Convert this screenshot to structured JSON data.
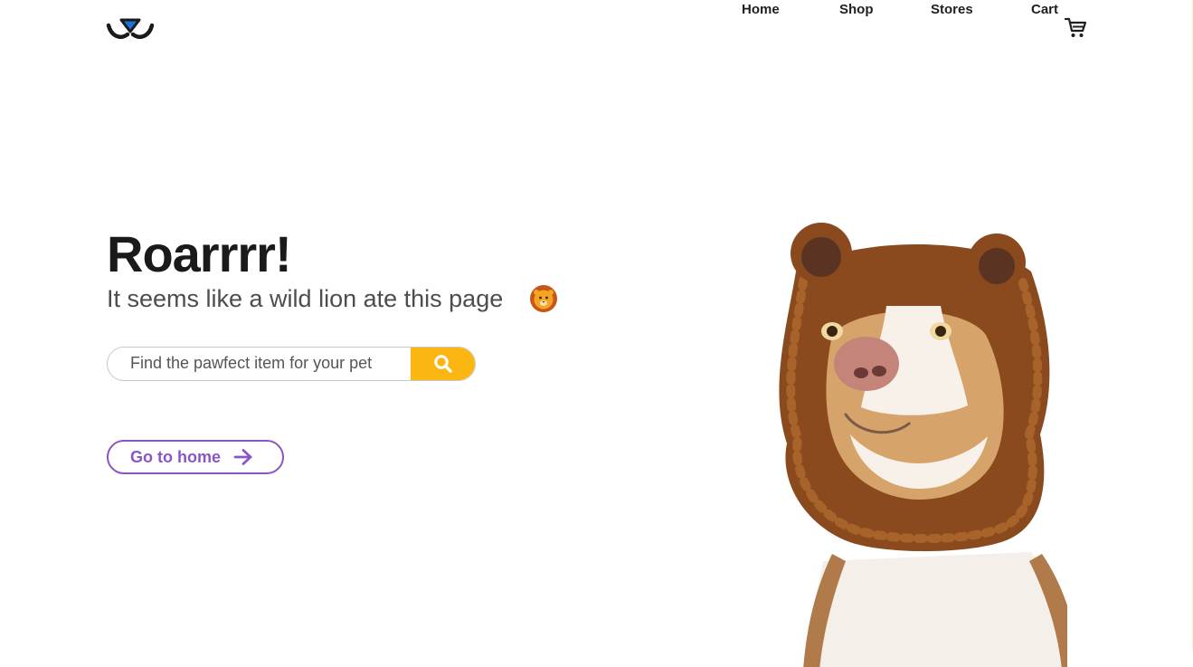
{
  "header": {
    "logo_icon": "paw-smile-logo-icon",
    "nav": {
      "home": "Home",
      "shop": "Shop",
      "stores": "Stores",
      "cart": "Cart"
    },
    "cart_icon": "shopping-cart-icon"
  },
  "hero": {
    "headline": "Roarrrr!",
    "subline": "It seems like a wild lion ate this page",
    "emoji_icon": "lion-face-emoji-icon"
  },
  "search": {
    "placeholder": "Find the pawfect item for your pet",
    "button_icon": "search-icon"
  },
  "home_button": {
    "label": "Go to home",
    "icon": "arrow-right-icon"
  },
  "image": {
    "subject": "dog-in-lion-hat-illustration"
  },
  "colors": {
    "accent_yellow": "#fbb612",
    "accent_purple": "#8a55c7",
    "text_dark": "#1a1a1a",
    "logo_blue": "#1c6fd6"
  }
}
